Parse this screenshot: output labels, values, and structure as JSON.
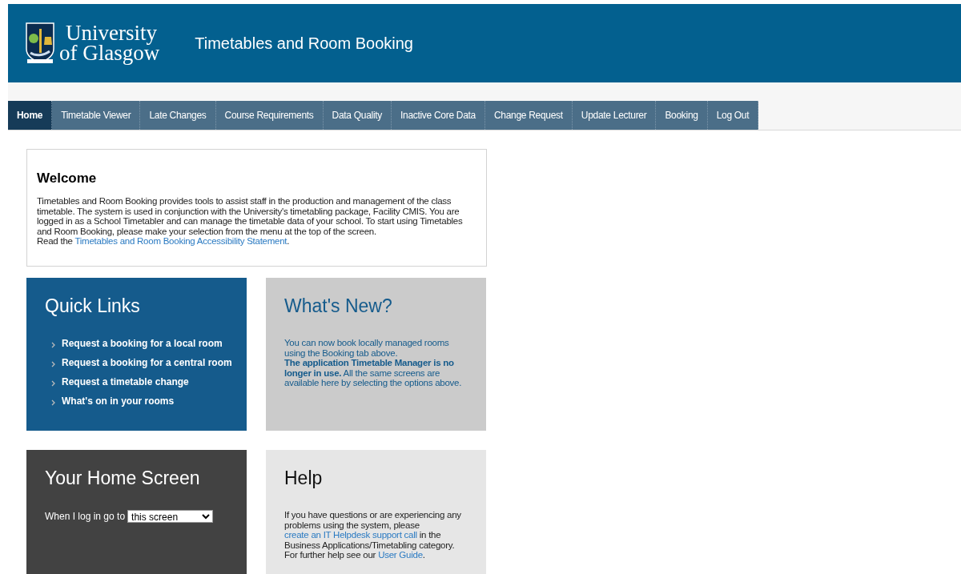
{
  "header": {
    "logo_line1": "University",
    "logo_line2": "of Glasgow",
    "title": "Timetables and Room Booking"
  },
  "nav": [
    {
      "label": "Home",
      "selected": true
    },
    {
      "label": "Timetable Viewer",
      "selected": false
    },
    {
      "label": "Late Changes",
      "selected": false
    },
    {
      "label": "Course Requirements",
      "selected": false
    },
    {
      "label": "Data Quality",
      "selected": false
    },
    {
      "label": "Inactive Core Data",
      "selected": false
    },
    {
      "label": "Change Request",
      "selected": false
    },
    {
      "label": "Update Lecturer",
      "selected": false
    },
    {
      "label": "Booking",
      "selected": false
    },
    {
      "label": "Log Out",
      "selected": false
    }
  ],
  "welcome": {
    "title": "Welcome",
    "lines": [
      [
        {
          "kind": "text",
          "text": "Timetables and Room Booking provides tools to assist staff in the production and management of the class timetable. The system is used in conjunction with the University's timetabling package, Facility CMIS. You are logged in as a School Timetabler and can manage the timetable data of your school. To start using Timetables and Room Booking, please make your selection from the menu at the top of the screen."
        }
      ],
      [
        {
          "kind": "text",
          "text": "Read the "
        },
        {
          "kind": "link",
          "text": "Timetables and Room Booking Accessibility Statement"
        },
        {
          "kind": "text",
          "text": "."
        }
      ]
    ]
  },
  "quick_links": {
    "title": "Quick Links",
    "links": [
      "Request a booking for a local room",
      "Request a booking for a central room",
      "Request a timetable change",
      "What's on in your rooms"
    ]
  },
  "whats_new": {
    "title": "What's New?",
    "lines": [
      [
        {
          "kind": "text",
          "text": "You can now book locally managed rooms using the Booking tab above."
        }
      ],
      [
        {
          "kind": "bold",
          "text": "The application Timetable Manager is no longer in use."
        },
        {
          "kind": "text",
          "text": " All the same screens are available here by selecting the options above."
        }
      ]
    ]
  },
  "home_screen": {
    "title": "Your Home Screen",
    "label": "When I log in go to",
    "value": "this screen"
  },
  "help": {
    "title": "Help",
    "lines": [
      [
        {
          "kind": "text",
          "text": "If you have questions or are experiencing any problems using the system, please "
        },
        {
          "kind": "link",
          "text": "create an IT Helpdesk support call"
        },
        {
          "kind": "text",
          "text": " in the Business Applications/Timetabling category."
        }
      ],
      [
        {
          "kind": "text",
          "text": "For further help see our "
        },
        {
          "kind": "link",
          "text": "User Guide"
        },
        {
          "kind": "text",
          "text": "."
        }
      ]
    ]
  }
}
